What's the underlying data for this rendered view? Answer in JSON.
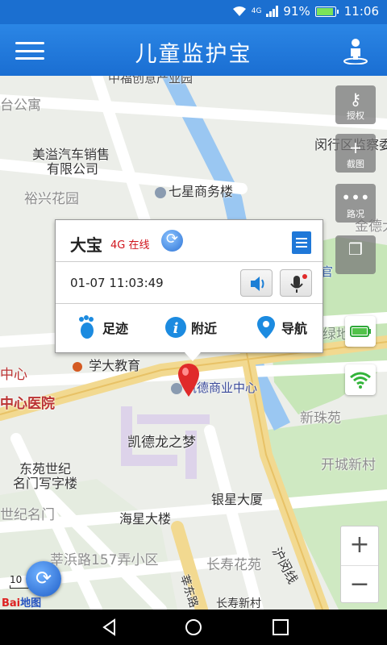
{
  "status": {
    "network": "4G",
    "battery": "91%",
    "time": "11:06"
  },
  "header": {
    "title": "儿童监护宝",
    "menu_icon": "hamburger-menu-icon",
    "user_icon": "user-location-icon"
  },
  "side_controls": [
    {
      "label": "授权",
      "icon": "key-icon"
    },
    {
      "label": "截图",
      "icon": "screenshot-icon"
    },
    {
      "label": "路况",
      "icon": "traffic-icon"
    },
    {
      "label": "",
      "icon": "layers-icon"
    }
  ],
  "popup": {
    "name": "大宝",
    "network_status": "4G 在线",
    "datetime": "01-07 11:03:49",
    "actions": [
      {
        "label": "足迹",
        "icon": "footprint-icon"
      },
      {
        "label": "附近",
        "icon": "info-icon"
      },
      {
        "label": "导航",
        "icon": "navigation-pin-icon"
      }
    ]
  },
  "map_labels": {
    "top_road": "中福创意产业园",
    "l_apt": "台公寓",
    "car": "美溢汽车销售",
    "car2": "有限公司",
    "yuxing": "裕兴花园",
    "qixing": "七星商务楼",
    "minhang": "闵行区监察委",
    "jinde": "金德大",
    "xueda": "学大教育",
    "kaide_center": "凯德商业中心",
    "center_hosp_top": "中心",
    "center_hosp": "中心医院",
    "kaidelong": "凯德龙之梦",
    "dongyuan": "东苑世纪",
    "mingmen": "名门写字楼",
    "shijimingmen": "世纪名门",
    "yinxing": "银星大厦",
    "haixing": "海星大楼",
    "xinzhuyuan": "新珠苑",
    "kaicheng": "开城新村",
    "xinzhu_road": "莘浜路157弄小区",
    "changshou": "长寿花苑",
    "changshou2": "长寿新村",
    "huqing": "沪闵线",
    "xindong": "莘东路",
    "lvdi": "绿地",
    "guan": "官"
  },
  "scale": "10",
  "baidu": {
    "a": "Bai",
    "b": "地图"
  },
  "zoom": {
    "in": "+",
    "out": "−"
  }
}
